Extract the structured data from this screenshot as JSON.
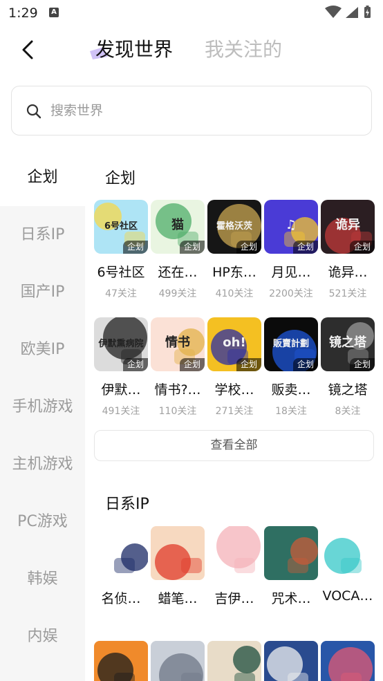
{
  "status_bar": {
    "time": "1:29",
    "notice_letter": "A"
  },
  "header": {
    "tab_active": "发现世界",
    "tab_inactive": "我关注的"
  },
  "search": {
    "placeholder": "搜索世界"
  },
  "sidebar": {
    "items": [
      {
        "label": "企划",
        "active": true
      },
      {
        "label": "日系IP",
        "active": false
      },
      {
        "label": "国产IP",
        "active": false
      },
      {
        "label": "欧美IP",
        "active": false
      },
      {
        "label": "手机游戏",
        "active": false
      },
      {
        "label": "主机游戏",
        "active": false
      },
      {
        "label": "PC游戏",
        "active": false
      },
      {
        "label": "韩娱",
        "active": false
      },
      {
        "label": "内娱",
        "active": false
      }
    ]
  },
  "sections": {
    "planning": {
      "title": "企划",
      "tag_label": "企划",
      "items": [
        {
          "name": "6号社区",
          "count": "47关注",
          "cover_text": "6号社区",
          "colors": [
            "#aee4f5",
            "#f6d84a"
          ]
        },
        {
          "name": "还在…",
          "count": "499关注",
          "cover_text": "猫",
          "colors": [
            "#e9f5e1",
            "#4fae6a"
          ]
        },
        {
          "name": "HP东…",
          "count": "410关注",
          "cover_text": "霍格沃茨",
          "colors": [
            "#161616",
            "#c8a552"
          ]
        },
        {
          "name": "月见…",
          "count": "2200关注",
          "cover_text": "♫",
          "colors": [
            "#4a3bd6",
            "#f3c52e"
          ]
        },
        {
          "name": "诡异…",
          "count": "521关注",
          "cover_text": "诡异",
          "colors": [
            "#2b1e22",
            "#c23a3a"
          ]
        },
        {
          "name": "伊默…",
          "count": "491关注",
          "cover_text": "伊默熏病院",
          "colors": [
            "#dcdcdc",
            "#222222"
          ]
        },
        {
          "name": "情书?…",
          "count": "110关注",
          "cover_text": "情书",
          "colors": [
            "#fbe1d6",
            "#e3b24a"
          ]
        },
        {
          "name": "学校…",
          "count": "271关注",
          "cover_text": "oh!",
          "colors": [
            "#f4c022",
            "#2d2fa3"
          ]
        },
        {
          "name": "贩卖…",
          "count": "18关注",
          "cover_text": "販賣計劃",
          "colors": [
            "#0b0b0b",
            "#1e56d8"
          ]
        },
        {
          "name": "镜之塔",
          "count": "8关注",
          "cover_text": "镜之塔",
          "colors": [
            "#2d2d2d",
            "#9a9a9a"
          ]
        }
      ]
    },
    "view_all_label": "查看全部",
    "japan_ip": {
      "title": "日系IP",
      "items": [
        {
          "name": "名侦…",
          "colors": [
            "#ffffff",
            "#1b2a66"
          ]
        },
        {
          "name": "蜡笔…",
          "colors": [
            "#f7d9c0",
            "#e03b2b"
          ]
        },
        {
          "name": "吉伊…",
          "colors": [
            "#ffffff",
            "#f4b2b8"
          ]
        },
        {
          "name": "咒术…",
          "colors": [
            "#2f6f62",
            "#c85b3a"
          ]
        },
        {
          "name": "VOCA…",
          "colors": [
            "#ffffff",
            "#35c8c8"
          ]
        }
      ],
      "more_colors": [
        [
          "#f08a2b",
          "#1c1c1c"
        ],
        [
          "#c9cfd8",
          "#6e7787"
        ],
        [
          "#e8dcc8",
          "#1f4f3f"
        ],
        [
          "#2a4b8f",
          "#f0f0f0"
        ],
        [
          "#2856a8",
          "#e25a73"
        ]
      ]
    }
  }
}
